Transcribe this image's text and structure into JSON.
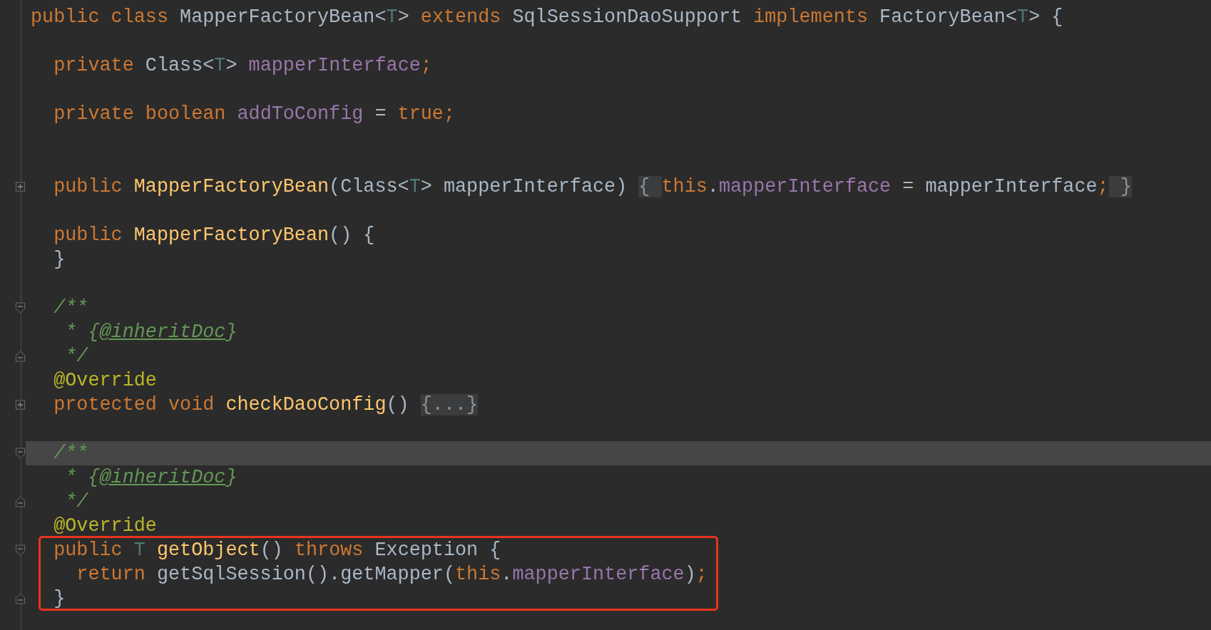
{
  "editor": {
    "lines": [
      {
        "current": false,
        "boxed": false,
        "tokens": [
          {
            "kind": "keyword",
            "text": "public class "
          },
          {
            "kind": "plain",
            "text": "MapperFactoryBean<"
          },
          {
            "kind": "type-param",
            "text": "T"
          },
          {
            "kind": "plain",
            "text": "> "
          },
          {
            "kind": "keyword",
            "text": "extends "
          },
          {
            "kind": "plain",
            "text": "SqlSessionDaoSupport "
          },
          {
            "kind": "keyword",
            "text": "implements "
          },
          {
            "kind": "plain",
            "text": "FactoryBean<"
          },
          {
            "kind": "type-param",
            "text": "T"
          },
          {
            "kind": "plain",
            "text": "> {"
          }
        ]
      },
      {
        "current": false,
        "boxed": false
      },
      {
        "current": false,
        "boxed": false,
        "tokens": [
          {
            "kind": "keyword",
            "text": "  private "
          },
          {
            "kind": "plain",
            "text": "Class<"
          },
          {
            "kind": "type-param",
            "text": "T"
          },
          {
            "kind": "plain",
            "text": "> "
          },
          {
            "kind": "field",
            "text": "mapperInterface"
          },
          {
            "kind": "keyword",
            "text": ";"
          }
        ]
      },
      {
        "current": false,
        "boxed": false
      },
      {
        "current": false,
        "boxed": false,
        "tokens": [
          {
            "kind": "keyword",
            "text": "  private boolean "
          },
          {
            "kind": "field",
            "text": "addToConfig"
          },
          {
            "kind": "plain",
            "text": " = "
          },
          {
            "kind": "keyword",
            "text": "true;"
          }
        ]
      },
      {
        "current": false,
        "boxed": false
      },
      {
        "current": false,
        "boxed": false
      },
      {
        "fold_marker": {
          "kind": "expand"
        },
        "current": false,
        "boxed": false,
        "tokens": [
          {
            "kind": "keyword",
            "text": "  public "
          },
          {
            "kind": "method",
            "text": "MapperFactoryBean"
          },
          {
            "kind": "plain",
            "text": "(Class<"
          },
          {
            "kind": "type-param",
            "text": "T"
          },
          {
            "kind": "plain",
            "text": "> mapperInterface) "
          },
          {
            "kind": "folded",
            "text": "{ "
          },
          {
            "kind": "keyword",
            "text": "this"
          },
          {
            "kind": "plain",
            "text": "."
          },
          {
            "kind": "field",
            "text": "mapperInterface"
          },
          {
            "kind": "plain",
            "text": " = mapperInterface"
          },
          {
            "kind": "keyword",
            "text": ";"
          },
          {
            "kind": "folded",
            "text": " }"
          }
        ]
      },
      {
        "current": false,
        "boxed": false
      },
      {
        "current": false,
        "boxed": false,
        "tokens": [
          {
            "kind": "keyword",
            "text": "  public "
          },
          {
            "kind": "method",
            "text": "MapperFactoryBean"
          },
          {
            "kind": "plain",
            "text": "() {"
          }
        ]
      },
      {
        "current": false,
        "boxed": false,
        "tokens": [
          {
            "kind": "plain",
            "text": "  }"
          }
        ]
      },
      {
        "current": false,
        "boxed": false
      },
      {
        "fold_marker": {
          "kind": "fold-start"
        },
        "current": false,
        "boxed": false,
        "tokens": [
          {
            "kind": "comment",
            "text": "  /**"
          }
        ]
      },
      {
        "current": false,
        "boxed": false,
        "tokens": [
          {
            "kind": "comment",
            "text": "   * {"
          },
          {
            "kind": "doc-tag",
            "text": "@inheritDoc"
          },
          {
            "kind": "comment",
            "text": "}"
          }
        ]
      },
      {
        "fold_marker": {
          "kind": "fold-end"
        },
        "current": false,
        "boxed": false,
        "tokens": [
          {
            "kind": "comment",
            "text": "   */"
          }
        ]
      },
      {
        "current": false,
        "boxed": false,
        "tokens": [
          {
            "kind": "annotation",
            "text": "  @Override"
          }
        ]
      },
      {
        "fold_marker": {
          "kind": "expand"
        },
        "current": false,
        "boxed": false,
        "tokens": [
          {
            "kind": "keyword",
            "text": "  protected void "
          },
          {
            "kind": "method",
            "text": "checkDaoConfig"
          },
          {
            "kind": "plain",
            "text": "() "
          },
          {
            "kind": "folded",
            "text": "{...}"
          }
        ]
      },
      {
        "current": false,
        "boxed": false
      },
      {
        "fold_marker": {
          "kind": "fold-start"
        },
        "current": true,
        "boxed": false,
        "tokens": [
          {
            "kind": "comment",
            "text": "  /**"
          }
        ]
      },
      {
        "current": false,
        "boxed": false,
        "tokens": [
          {
            "kind": "comment",
            "text": "   * {"
          },
          {
            "kind": "doc-tag",
            "text": "@inheritDoc"
          },
          {
            "kind": "comment",
            "text": "}"
          }
        ]
      },
      {
        "fold_marker": {
          "kind": "fold-end"
        },
        "current": false,
        "boxed": false,
        "tokens": [
          {
            "kind": "comment",
            "text": "   */"
          }
        ]
      },
      {
        "current": false,
        "boxed": false,
        "tokens": [
          {
            "kind": "annotation",
            "text": "  @Override"
          }
        ]
      },
      {
        "fold_marker": {
          "kind": "fold-start"
        },
        "current": false,
        "boxed": true,
        "tokens": [
          {
            "kind": "keyword",
            "text": "  public "
          },
          {
            "kind": "type-param",
            "text": "T "
          },
          {
            "kind": "method",
            "text": "getObject"
          },
          {
            "kind": "plain",
            "text": "() "
          },
          {
            "kind": "keyword",
            "text": "throws "
          },
          {
            "kind": "plain",
            "text": "Exception {"
          }
        ]
      },
      {
        "current": false,
        "boxed": true,
        "tokens": [
          {
            "kind": "keyword",
            "text": "    return "
          },
          {
            "kind": "plain",
            "text": "getSqlSession().getMapper("
          },
          {
            "kind": "keyword",
            "text": "this"
          },
          {
            "kind": "plain",
            "text": "."
          },
          {
            "kind": "field",
            "text": "mapperInterface"
          },
          {
            "kind": "plain",
            "text": ")"
          },
          {
            "kind": "keyword",
            "text": ";"
          }
        ]
      },
      {
        "fold_marker": {
          "kind": "fold-end"
        },
        "current": false,
        "boxed": true,
        "tokens": [
          {
            "kind": "plain",
            "text": "  }"
          }
        ]
      }
    ]
  }
}
